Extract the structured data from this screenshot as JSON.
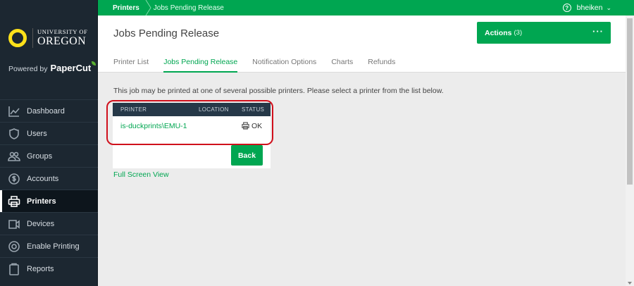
{
  "brand": {
    "university_line1": "UNIVERSITY OF",
    "university_line2": "OREGON",
    "powered_by": "Powered by",
    "product": "PaperCut"
  },
  "sidebar": {
    "items": [
      {
        "label": "Dashboard",
        "icon": "chart-line-icon"
      },
      {
        "label": "Users",
        "icon": "shield-user-icon"
      },
      {
        "label": "Groups",
        "icon": "people-icon"
      },
      {
        "label": "Accounts",
        "icon": "dollar-circle-icon"
      },
      {
        "label": "Printers",
        "icon": "printer-icon",
        "active": true
      },
      {
        "label": "Devices",
        "icon": "device-icon"
      },
      {
        "label": "Enable Printing",
        "icon": "enable-printing-icon"
      },
      {
        "label": "Reports",
        "icon": "clipboard-icon"
      }
    ]
  },
  "topbar": {
    "breadcrumb_root": "Printers",
    "breadcrumb_current": "Jobs Pending Release",
    "username": "bheiken"
  },
  "header": {
    "title": "Jobs Pending Release",
    "actions_label": "Actions",
    "actions_count": "(3)",
    "actions_more": "···"
  },
  "tabs": [
    {
      "label": "Printer List"
    },
    {
      "label": "Jobs Pending Release",
      "active": true
    },
    {
      "label": "Notification Options"
    },
    {
      "label": "Charts"
    },
    {
      "label": "Refunds"
    }
  ],
  "main": {
    "message": "This job may be printed at one of several possible printers. Please select a printer from the list below.",
    "table": {
      "columns": [
        "PRINTER",
        "LOCATION",
        "STATUS"
      ],
      "rows": [
        {
          "printer": "is-duckprints\\EMU-1",
          "location": "",
          "status": "OK"
        }
      ]
    },
    "back_label": "Back",
    "full_screen_label": "Full Screen View"
  },
  "colors": {
    "accent": "#00a651",
    "sidebar_bg": "#1c2731",
    "highlight": "#d0101c",
    "logo_yellow": "#fee11a"
  }
}
